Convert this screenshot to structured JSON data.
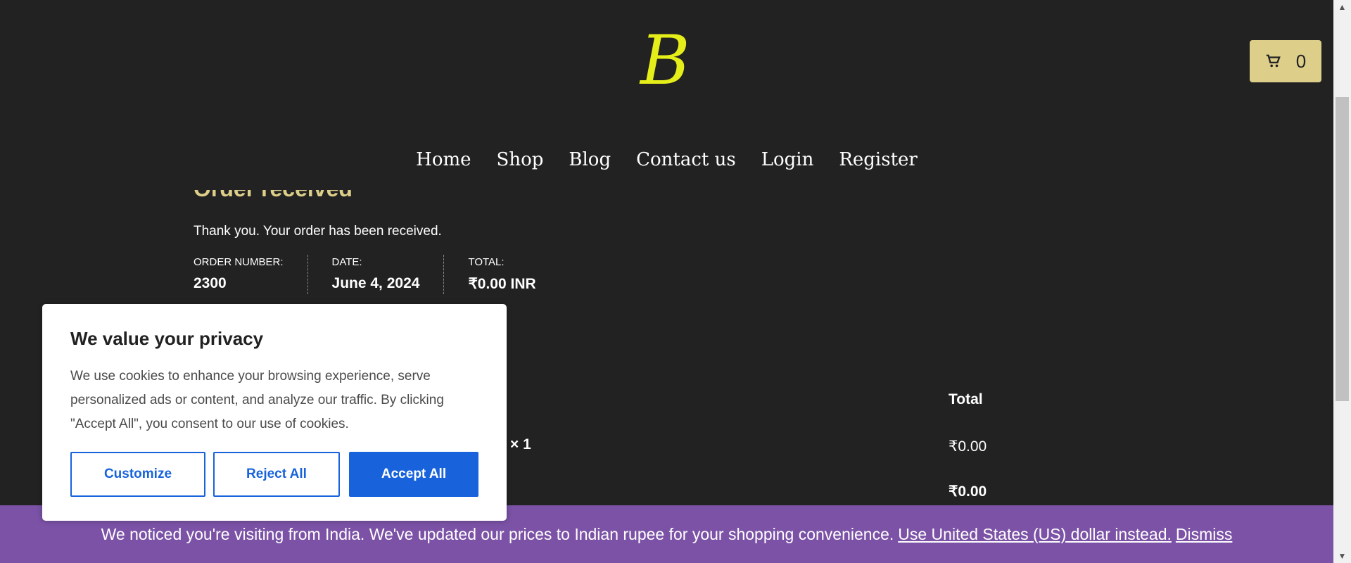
{
  "header": {
    "logo_text": "B",
    "cart_count": "0",
    "cart_icon": "cart-icon"
  },
  "nav": [
    "Home",
    "Shop",
    "Blog",
    "Contact us",
    "Login",
    "Register"
  ],
  "order": {
    "title": "Order received",
    "thanks": "Thank you. Your order has been received.",
    "overview": [
      {
        "label": "Order number:",
        "value": "2300"
      },
      {
        "label": "Date:",
        "value": "June 4, 2024"
      },
      {
        "label": "Total:",
        "value": "₹0.00 INR"
      }
    ],
    "table": {
      "total_header": "Total",
      "qty": "× 1",
      "line_total": "₹0.00",
      "grand_total": "₹0.00"
    }
  },
  "cookie": {
    "title": "We value your privacy",
    "body": "We use cookies to enhance your browsing experience, serve personalized ads or content, and analyze our traffic. By clicking \"Accept All\", you consent to our use of cookies.",
    "customize": "Customize",
    "reject": "Reject All",
    "accept": "Accept All"
  },
  "geo": {
    "message": "We noticed you're visiting from India. We've updated our prices to Indian rupee for your shopping convenience.",
    "switch_link": "Use United States (US) dollar instead.",
    "dismiss": "Dismiss"
  },
  "colors": {
    "background": "#222222",
    "accent_gold": "#ddcf8a",
    "logo_yellow": "#e6ee1a",
    "cookie_blue": "#1863dc",
    "geo_purple": "#7b52a6"
  }
}
